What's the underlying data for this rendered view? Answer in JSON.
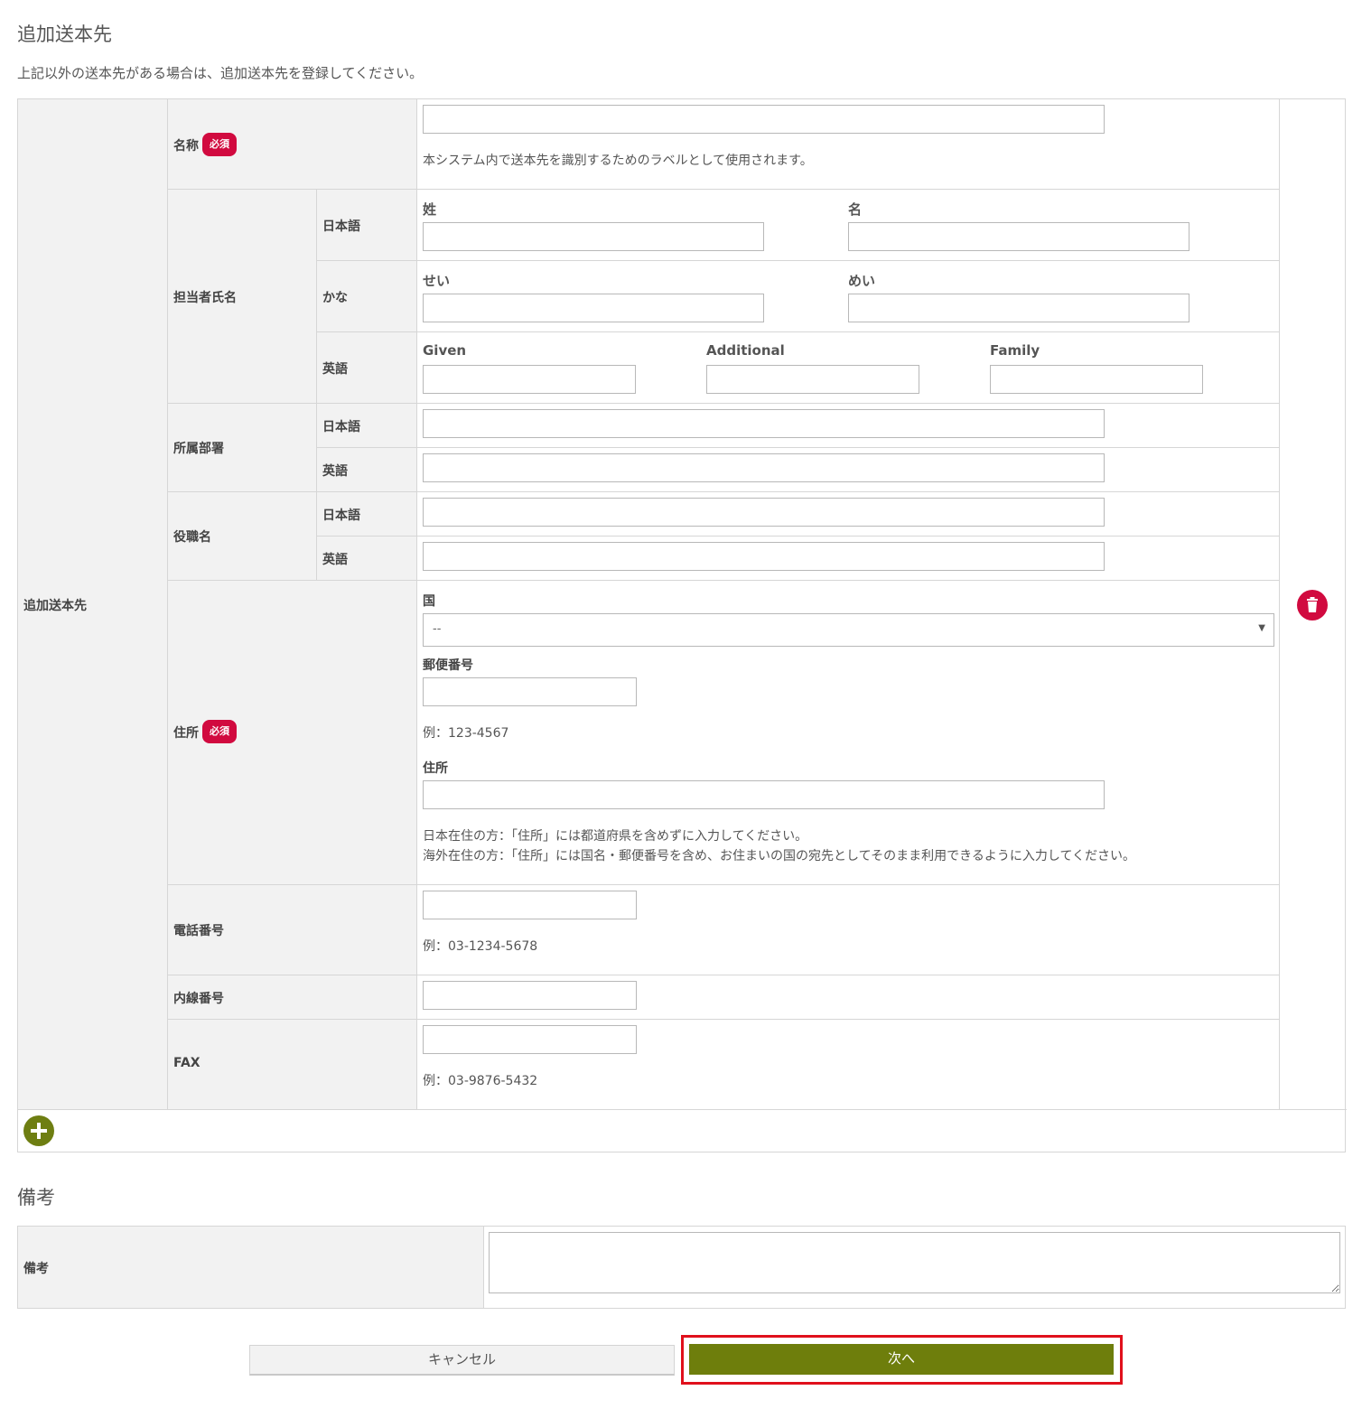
{
  "section1": {
    "title": "追加送本先",
    "intro": "上記以外の送本先がある場合は、追加送本先を登録してください。",
    "group_label": "追加送本先",
    "required_badge": "必須",
    "name": {
      "label": "名称",
      "help": "本システム内で送本先を識別するためのラベルとして使用されます。"
    },
    "contact": {
      "label": "担当者氏名",
      "japanese": {
        "label": "日本語",
        "last": "姓",
        "first": "名"
      },
      "kana": {
        "label": "かな",
        "last": "せい",
        "first": "めい"
      },
      "english": {
        "label": "英語",
        "given": "Given",
        "additional": "Additional",
        "family": "Family"
      }
    },
    "department": {
      "label": "所属部署",
      "japanese": "日本語",
      "english": "英語"
    },
    "position": {
      "label": "役職名",
      "japanese": "日本語",
      "english": "英語"
    },
    "address": {
      "label": "住所",
      "country_label": "国",
      "country_value": "--",
      "postal_label": "郵便番号",
      "postal_help": "例：123-4567",
      "address_label": "住所",
      "help_line1": "日本在住の方：「住所」には都道府県を含めずに入力してください。",
      "help_line2": "海外在住の方：「住所」には国名・郵便番号を含め、お住まいの国の宛先としてそのまま利用できるように入力してください。"
    },
    "phone": {
      "label": "電話番号",
      "help": "例：03-1234-5678"
    },
    "extension": {
      "label": "内線番号"
    },
    "fax": {
      "label": "FAX",
      "help": "例：03-9876-5432"
    },
    "delete_icon": "trash-icon",
    "add_icon": "plus-circle-icon",
    "colors": {
      "required": "#d10a3f",
      "add": "#6e7e12"
    }
  },
  "section2": {
    "title": "備考",
    "notes_label": "備考"
  },
  "buttons": {
    "cancel": "キャンセル",
    "next": "次へ",
    "colors": {
      "next": "#6e7e0c",
      "highlight": "#e0101c"
    }
  }
}
